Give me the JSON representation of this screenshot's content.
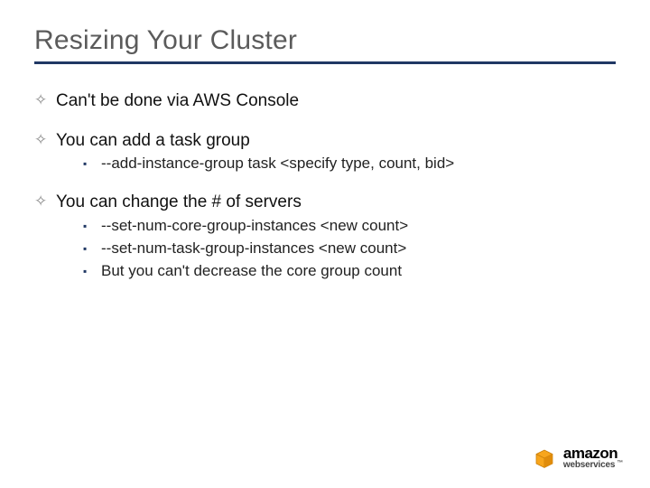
{
  "title": "Resizing Your Cluster",
  "bullets": [
    {
      "text": "Can't be done via AWS Console",
      "sub": []
    },
    {
      "text": "You can add a task group",
      "sub": [
        "--add-instance-group task <specify type, count, bid>"
      ]
    },
    {
      "text": "You can change the # of servers",
      "sub": [
        "--set-num-core-group-instances <new count>",
        "--set-num-task-group-instances <new count>",
        "But you can't decrease the core group count"
      ]
    }
  ],
  "logo": {
    "line1": "amazon",
    "line2": "webservices"
  }
}
